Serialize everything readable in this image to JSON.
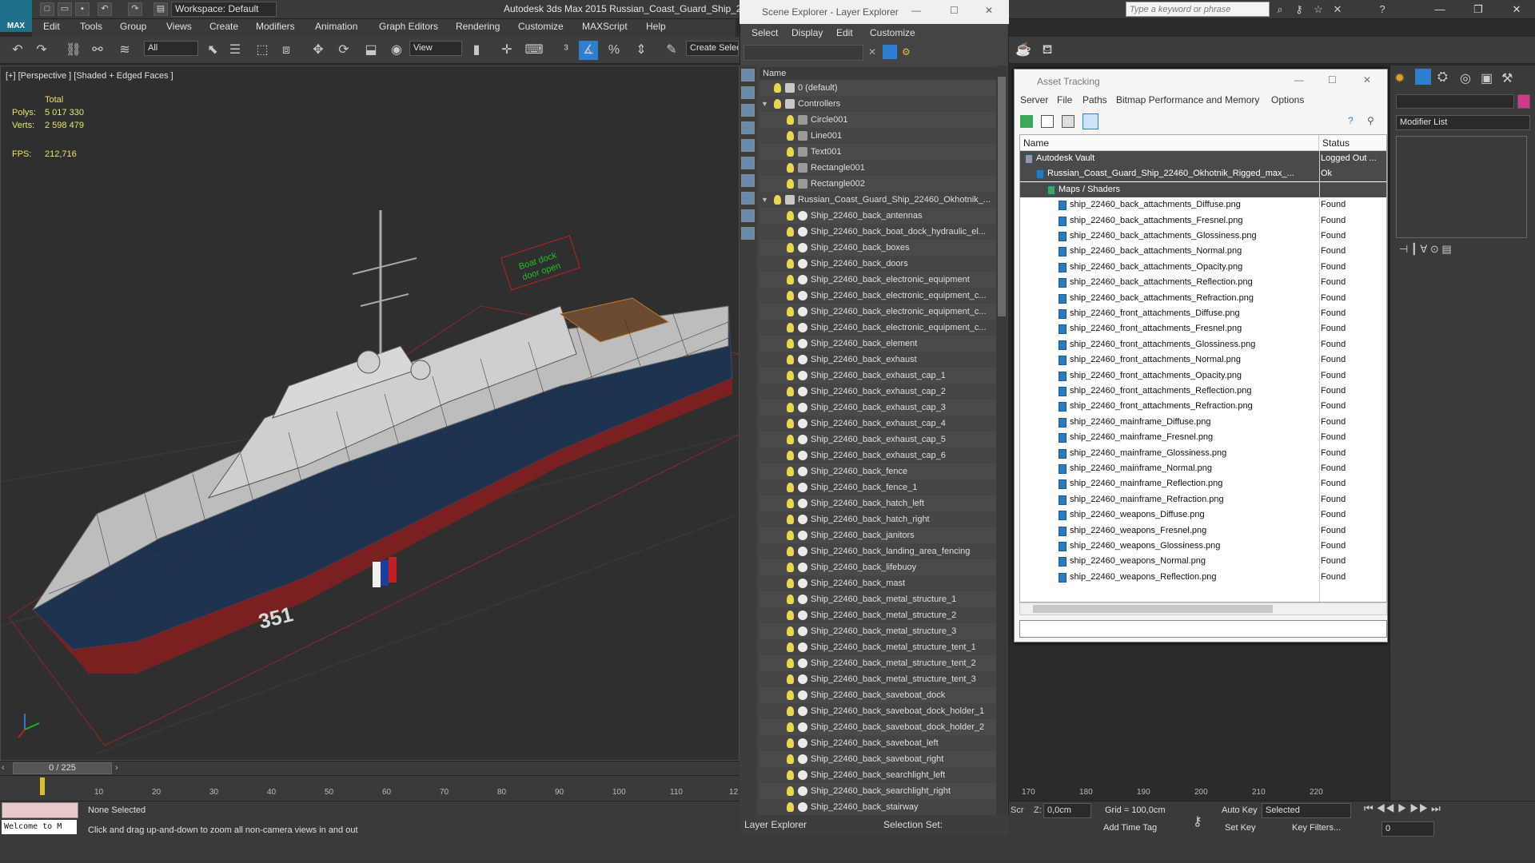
{
  "titlebar": {
    "workspace": "Workspace: Default",
    "app_title": "Autodesk 3ds Max  2015     Russian_Coast_Guard_Ship_2",
    "search_placeholder": "Type a keyword or phrase",
    "logo": "MAX"
  },
  "menubar": [
    "Edit",
    "Tools",
    "Group",
    "Views",
    "Create",
    "Modifiers",
    "Animation",
    "Graph Editors",
    "Rendering",
    "Customize",
    "MAXScript",
    "Help"
  ],
  "toolbar": {
    "selection_filter": "All",
    "ref_coord": "View",
    "create_selection": "Create Selection Se"
  },
  "viewport": {
    "label": "[+] [Perspective ] [Shaded + Edged Faces ]",
    "stats": {
      "header": "Total",
      "polys_label": "Polys:",
      "polys": "5 017 330",
      "verts_label": "Verts:",
      "verts": "2 598 479",
      "fps_label": "FPS:",
      "fps": "212,716"
    },
    "hull_number": "351",
    "sign_line1": "Boat dock",
    "sign_line2": "door open"
  },
  "timeline": {
    "frame": "0 / 225",
    "ticks": [
      "10",
      "20",
      "30",
      "40",
      "50",
      "60",
      "70",
      "80",
      "90",
      "100",
      "110",
      "12",
      "170",
      "180",
      "190",
      "200",
      "210",
      "220"
    ]
  },
  "status": {
    "selection": "None Selected",
    "prompt": "Click and drag up-and-down to zoom all non-camera views in and out",
    "welcome": "Welcome to M",
    "grid": "Grid = 100,0cm",
    "z_label": "Z:",
    "z_value": "0,0cm",
    "add_time_tag": "Add Time Tag",
    "auto_key": "Auto Key",
    "set_key": "Set Key",
    "key_mode": "Selected",
    "key_filters": "Key Filters...",
    "frame_field": "0",
    "scr": "Scr"
  },
  "scene_explorer": {
    "title": "Scene Explorer - Layer Explorer",
    "menus": [
      "Select",
      "Display",
      "Edit",
      "Customize"
    ],
    "column": "Name",
    "footer": "Layer Explorer",
    "selection_set": "Selection Set:",
    "rows": [
      {
        "indent": 1,
        "kind": "layer",
        "label": "0 (default)"
      },
      {
        "indent": 1,
        "kind": "layer",
        "label": "Controllers",
        "expand": "▼"
      },
      {
        "indent": 2,
        "kind": "shape",
        "label": "Circle001"
      },
      {
        "indent": 2,
        "kind": "shape",
        "label": "Line001"
      },
      {
        "indent": 2,
        "kind": "shape",
        "label": "Text001"
      },
      {
        "indent": 2,
        "kind": "shape",
        "label": "Rectangle001"
      },
      {
        "indent": 2,
        "kind": "shape",
        "label": "Rectangle002"
      },
      {
        "indent": 1,
        "kind": "layer",
        "label": "Russian_Coast_Guard_Ship_22460_Okhotnik_...",
        "expand": "▼"
      },
      {
        "indent": 2,
        "kind": "obj",
        "label": "Ship_22460_back_antennas"
      },
      {
        "indent": 2,
        "kind": "obj",
        "label": "Ship_22460_back_boat_dock_hydraulic_el..."
      },
      {
        "indent": 2,
        "kind": "obj",
        "label": "Ship_22460_back_boxes"
      },
      {
        "indent": 2,
        "kind": "obj",
        "label": "Ship_22460_back_doors"
      },
      {
        "indent": 2,
        "kind": "obj",
        "label": "Ship_22460_back_electronic_equipment"
      },
      {
        "indent": 2,
        "kind": "obj",
        "label": "Ship_22460_back_electronic_equipment_c..."
      },
      {
        "indent": 2,
        "kind": "obj",
        "label": "Ship_22460_back_electronic_equipment_c..."
      },
      {
        "indent": 2,
        "kind": "obj",
        "label": "Ship_22460_back_electronic_equipment_c..."
      },
      {
        "indent": 2,
        "kind": "obj",
        "label": "Ship_22460_back_element"
      },
      {
        "indent": 2,
        "kind": "obj",
        "label": "Ship_22460_back_exhaust"
      },
      {
        "indent": 2,
        "kind": "obj",
        "label": "Ship_22460_back_exhaust_cap_1"
      },
      {
        "indent": 2,
        "kind": "obj",
        "label": "Ship_22460_back_exhaust_cap_2"
      },
      {
        "indent": 2,
        "kind": "obj",
        "label": "Ship_22460_back_exhaust_cap_3"
      },
      {
        "indent": 2,
        "kind": "obj",
        "label": "Ship_22460_back_exhaust_cap_4"
      },
      {
        "indent": 2,
        "kind": "obj",
        "label": "Ship_22460_back_exhaust_cap_5"
      },
      {
        "indent": 2,
        "kind": "obj",
        "label": "Ship_22460_back_exhaust_cap_6"
      },
      {
        "indent": 2,
        "kind": "obj",
        "label": "Ship_22460_back_fence"
      },
      {
        "indent": 2,
        "kind": "obj",
        "label": "Ship_22460_back_fence_1"
      },
      {
        "indent": 2,
        "kind": "obj",
        "label": "Ship_22460_back_hatch_left"
      },
      {
        "indent": 2,
        "kind": "obj",
        "label": "Ship_22460_back_hatch_right"
      },
      {
        "indent": 2,
        "kind": "obj",
        "label": "Ship_22460_back_janitors"
      },
      {
        "indent": 2,
        "kind": "obj",
        "label": "Ship_22460_back_landing_area_fencing"
      },
      {
        "indent": 2,
        "kind": "obj",
        "label": "Ship_22460_back_lifebuoy"
      },
      {
        "indent": 2,
        "kind": "obj",
        "label": "Ship_22460_back_mast"
      },
      {
        "indent": 2,
        "kind": "obj",
        "label": "Ship_22460_back_metal_structure_1"
      },
      {
        "indent": 2,
        "kind": "obj",
        "label": "Ship_22460_back_metal_structure_2"
      },
      {
        "indent": 2,
        "kind": "obj",
        "label": "Ship_22460_back_metal_structure_3"
      },
      {
        "indent": 2,
        "kind": "obj",
        "label": "Ship_22460_back_metal_structure_tent_1"
      },
      {
        "indent": 2,
        "kind": "obj",
        "label": "Ship_22460_back_metal_structure_tent_2"
      },
      {
        "indent": 2,
        "kind": "obj",
        "label": "Ship_22460_back_metal_structure_tent_3"
      },
      {
        "indent": 2,
        "kind": "obj",
        "label": "Ship_22460_back_saveboat_dock"
      },
      {
        "indent": 2,
        "kind": "obj",
        "label": "Ship_22460_back_saveboat_dock_holder_1"
      },
      {
        "indent": 2,
        "kind": "obj",
        "label": "Ship_22460_back_saveboat_dock_holder_2"
      },
      {
        "indent": 2,
        "kind": "obj",
        "label": "Ship_22460_back_saveboat_left"
      },
      {
        "indent": 2,
        "kind": "obj",
        "label": "Ship_22460_back_saveboat_right"
      },
      {
        "indent": 2,
        "kind": "obj",
        "label": "Ship_22460_back_searchlight_left"
      },
      {
        "indent": 2,
        "kind": "obj",
        "label": "Ship_22460_back_searchlight_right"
      },
      {
        "indent": 2,
        "kind": "obj",
        "label": "Ship_22460_back_stairway"
      }
    ]
  },
  "asset_tracking": {
    "title": "Asset Tracking",
    "menus": [
      "Server",
      "File",
      "Paths",
      "Bitmap Performance and Memory",
      "Options"
    ],
    "columns": [
      "Name",
      "Status"
    ],
    "rows": [
      {
        "indent": 0,
        "name": "Autodesk Vault",
        "status": "Logged Out ..."
      },
      {
        "indent": 1,
        "name": "Russian_Coast_Guard_Ship_22460_Okhotnik_Rigged_max_...",
        "status": "Ok"
      },
      {
        "indent": 2,
        "name": "Maps / Shaders",
        "status": ""
      },
      {
        "indent": 3,
        "name": "ship_22460_back_attachments_Diffuse.png",
        "status": "Found"
      },
      {
        "indent": 3,
        "name": "ship_22460_back_attachments_Fresnel.png",
        "status": "Found"
      },
      {
        "indent": 3,
        "name": "ship_22460_back_attachments_Glossiness.png",
        "status": "Found"
      },
      {
        "indent": 3,
        "name": "ship_22460_back_attachments_Normal.png",
        "status": "Found"
      },
      {
        "indent": 3,
        "name": "ship_22460_back_attachments_Opacity.png",
        "status": "Found"
      },
      {
        "indent": 3,
        "name": "ship_22460_back_attachments_Reflection.png",
        "status": "Found"
      },
      {
        "indent": 3,
        "name": "ship_22460_back_attachments_Refraction.png",
        "status": "Found"
      },
      {
        "indent": 3,
        "name": "ship_22460_front_attachments_Diffuse.png",
        "status": "Found"
      },
      {
        "indent": 3,
        "name": "ship_22460_front_attachments_Fresnel.png",
        "status": "Found"
      },
      {
        "indent": 3,
        "name": "ship_22460_front_attachments_Glossiness.png",
        "status": "Found"
      },
      {
        "indent": 3,
        "name": "ship_22460_front_attachments_Normal.png",
        "status": "Found"
      },
      {
        "indent": 3,
        "name": "ship_22460_front_attachments_Opacity.png",
        "status": "Found"
      },
      {
        "indent": 3,
        "name": "ship_22460_front_attachments_Reflection.png",
        "status": "Found"
      },
      {
        "indent": 3,
        "name": "ship_22460_front_attachments_Refraction.png",
        "status": "Found"
      },
      {
        "indent": 3,
        "name": "ship_22460_mainframe_Diffuse.png",
        "status": "Found"
      },
      {
        "indent": 3,
        "name": "ship_22460_mainframe_Fresnel.png",
        "status": "Found"
      },
      {
        "indent": 3,
        "name": "ship_22460_mainframe_Glossiness.png",
        "status": "Found"
      },
      {
        "indent": 3,
        "name": "ship_22460_mainframe_Normal.png",
        "status": "Found"
      },
      {
        "indent": 3,
        "name": "ship_22460_mainframe_Reflection.png",
        "status": "Found"
      },
      {
        "indent": 3,
        "name": "ship_22460_mainframe_Refraction.png",
        "status": "Found"
      },
      {
        "indent": 3,
        "name": "ship_22460_weapons_Diffuse.png",
        "status": "Found"
      },
      {
        "indent": 3,
        "name": "ship_22460_weapons_Fresnel.png",
        "status": "Found"
      },
      {
        "indent": 3,
        "name": "ship_22460_weapons_Glossiness.png",
        "status": "Found"
      },
      {
        "indent": 3,
        "name": "ship_22460_weapons_Normal.png",
        "status": "Found"
      },
      {
        "indent": 3,
        "name": "ship_22460_weapons_Reflection.png",
        "status": "Found"
      }
    ]
  },
  "command_panel": {
    "modifier_list": "Modifier List",
    "swatch_color": "#d03a8a"
  }
}
